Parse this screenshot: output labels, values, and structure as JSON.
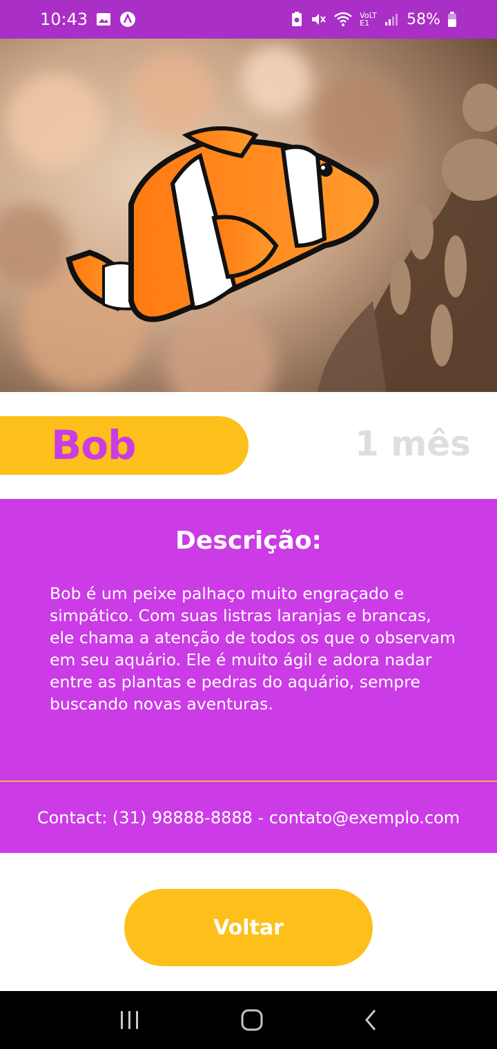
{
  "status_bar": {
    "time": "10:43",
    "battery": "58%",
    "network": "VoLTE1"
  },
  "pet": {
    "name": "Bob",
    "age": "1 mês"
  },
  "description": {
    "title": "Descrição:",
    "text": "Bob é um peixe palhaço muito engraçado e simpático. Com suas listras laranjas e brancas, ele chama a atenção de todos os que o observam em seu aquário. Ele é muito ágil e adora nadar entre as plantas e pedras do aquário, sempre buscando novas aventuras."
  },
  "contact": {
    "text": "Contact: (31) 98888-8888 - contato@exemplo.com"
  },
  "actions": {
    "back_label": "Voltar"
  },
  "colors": {
    "purple": "#cb3be6",
    "status_purple": "#a92fc6",
    "yellow": "#fdc01a",
    "age_gray": "#dedede"
  },
  "icons": [
    "image-icon",
    "app-icon",
    "battery-saver-icon",
    "mute-icon",
    "wifi-icon",
    "signal-icon",
    "battery-icon",
    "recent-apps-icon",
    "home-icon",
    "back-icon"
  ]
}
